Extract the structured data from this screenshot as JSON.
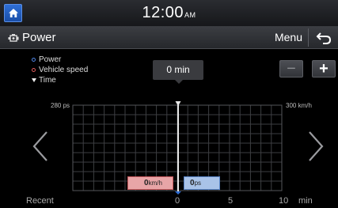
{
  "status_bar": {
    "time": "12:00",
    "ampm": "AM"
  },
  "title_bar": {
    "title": "Power",
    "menu_label": "Menu"
  },
  "legend": {
    "items": [
      {
        "label": "Power",
        "color": "#4f86e6",
        "icon": "circle-outline"
      },
      {
        "label": "Vehicle speed",
        "color": "#e05a5a",
        "icon": "circle-outline"
      },
      {
        "label": "Time",
        "color": "#eeeeee",
        "icon": "down-triangle"
      }
    ]
  },
  "time_tooltip": "0 min",
  "zoom": {
    "minus": "−",
    "plus": "+"
  },
  "axes": {
    "left_max": "280 ps",
    "right_max": "300 km/h"
  },
  "x_axis": {
    "recent_label": "Recent",
    "ticks": [
      "0",
      "5",
      "10"
    ],
    "unit": "min"
  },
  "tags": {
    "speed_value": "0",
    "speed_unit": "km/h",
    "power_value": "0",
    "power_unit": "ps"
  },
  "colors": {
    "speed": "#e05a5a",
    "power": "#4f86e6",
    "home_button": "#2360c4"
  }
}
